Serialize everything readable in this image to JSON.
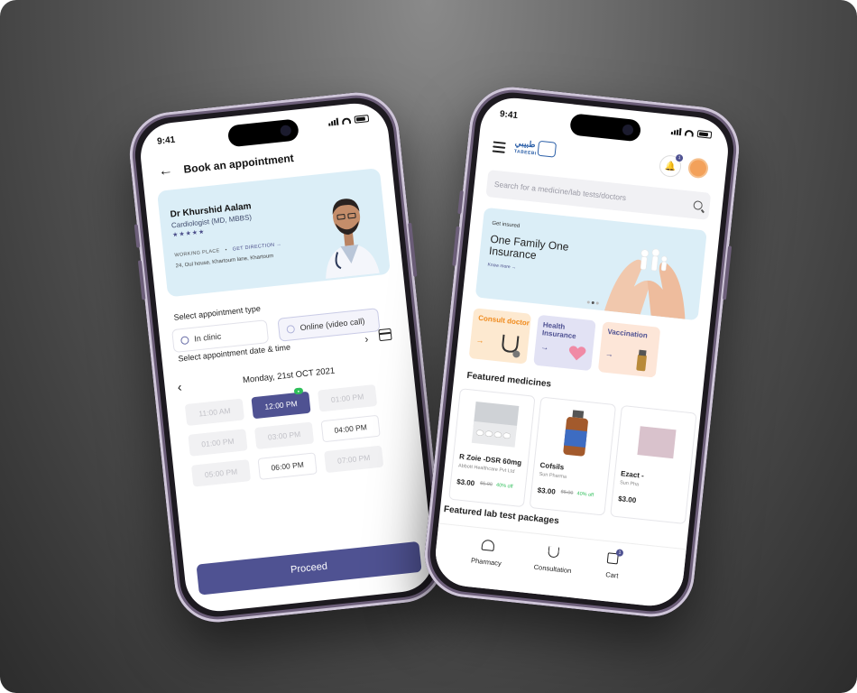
{
  "left_phone": {
    "status_time": "9:41",
    "title": "Book an appointment",
    "doctor": {
      "name": "Dr Khurshid Aalam",
      "specialty": "Cardiologist (MD, MBBS)",
      "stars": "★★★★★",
      "links": [
        "WORKING PLACE",
        "GET DIRECTION →"
      ],
      "address": "24, Oul house, Khartoum lane, Khartoum"
    },
    "type_label": "Select appointment type",
    "type_options": [
      "In clinic",
      "Online (video call)"
    ],
    "datetime_label": "Select appointment date & time",
    "date": "Monday, 21st OCT 2021",
    "slots": [
      "11:00 AM",
      "12:00 PM",
      "01:00 PM",
      "01:00 PM",
      "03:00 PM",
      "04:00 PM",
      "05:00 PM",
      "06:00 PM",
      "07:00 PM"
    ],
    "slot_tag": "",
    "proceed": "Proceed"
  },
  "right_phone": {
    "status_time": "9:41",
    "logo_text": "طبيبي",
    "logo_sub": "TABEEBI",
    "bell_count": "1",
    "search_placeholder": "Search for a medicine/lab tests/doctors",
    "banner": {
      "kicker": "Get insured",
      "headline": "One Family One Insurance",
      "link": "Know more →"
    },
    "categories": [
      {
        "title": "Consult doctor",
        "arrow": "→"
      },
      {
        "title": "Health Insurance",
        "arrow": "→"
      },
      {
        "title": "Vaccination",
        "arrow": "→"
      }
    ],
    "featured_title": "Featured  medicines",
    "medicines": [
      {
        "name": "R Zoie -DSR 60mg",
        "maker": "Abbott Healthcare Pvt Ltd",
        "price": "$3.00",
        "old": "$5.00",
        "off": "40% off"
      },
      {
        "name": "Cofsils",
        "maker": "Sun Pharma",
        "price": "$3.00",
        "old": "$5.00",
        "off": "40% off"
      },
      {
        "name": "Ezact -",
        "maker": "Sun Pha",
        "price": "$3.00",
        "old": "",
        "off": ""
      }
    ],
    "lab_title": "Featured lab test packages",
    "nav": [
      "Pharmacy",
      "Consultation",
      "Cart"
    ],
    "cart_count": "1"
  },
  "colors": {
    "primary": "#4f5292",
    "banner_bg": "#dbeef7",
    "success": "#2fbf5a"
  }
}
